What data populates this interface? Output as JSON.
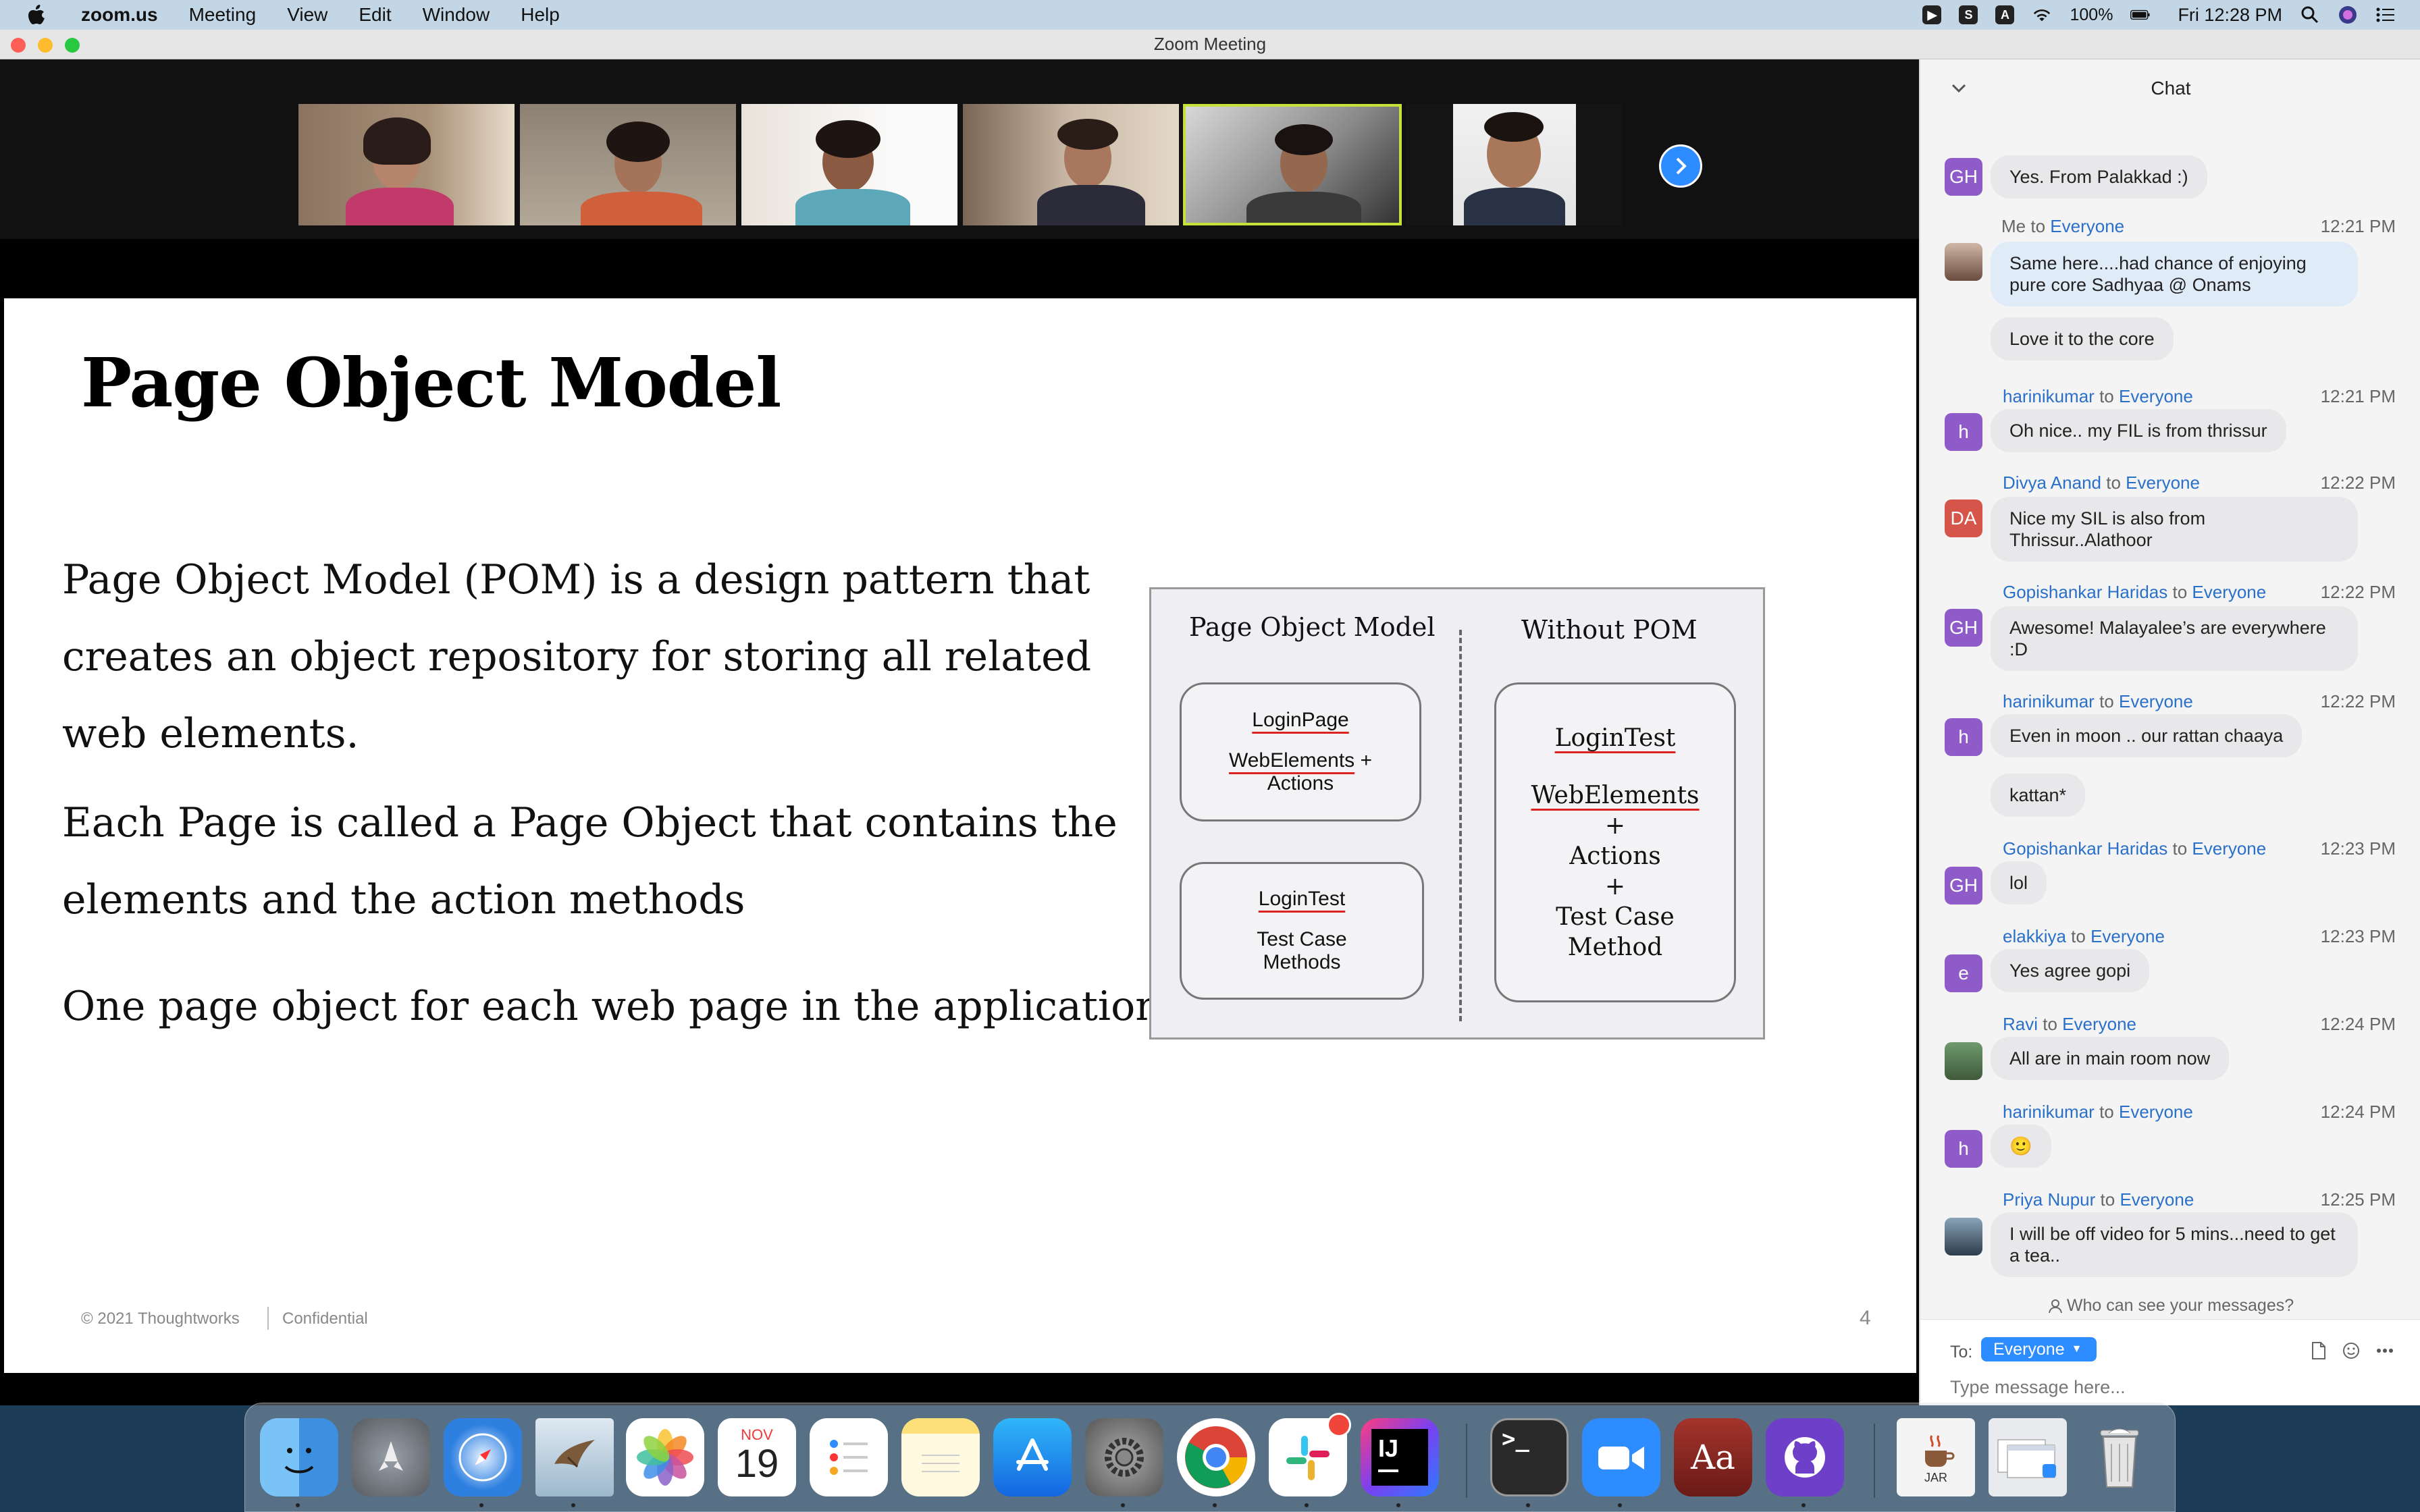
{
  "menubar": {
    "app_name": "zoom.us",
    "menus": [
      "Meeting",
      "View",
      "Edit",
      "Window",
      "Help"
    ],
    "battery": "100%",
    "clock": "Fri 12:28 PM"
  },
  "window": {
    "title": "Zoom Meeting"
  },
  "slide": {
    "title": "Page Object Model",
    "para1_line1": "Page Object Model (POM) is a design pattern that",
    "para1_line2": "creates an object repository for storing all related",
    "para1_line3": "web elements.",
    "para2_line1": "Each Page is called a Page Object that contains the",
    "para2_line2": "elements and the action methods",
    "para3": "One page object for each web page in the application",
    "footer_copyright": "© 2021 Thoughtworks",
    "footer_confidential": "Confidential",
    "page_number": "4",
    "diagram": {
      "left_heading": "Page Object Model",
      "right_heading": "Without POM",
      "box1_title": "LoginPage",
      "box1_line1": "WebElements",
      "box1_plus": "+",
      "box1_line2": "Actions",
      "box2_title": "LoginTest",
      "box2_line1": "Test Case",
      "box2_line2": "Methods",
      "box3_title": "LoginTest",
      "box3_line1": "WebElements",
      "box3_plus1": "+",
      "box3_line2": "Actions",
      "box3_plus2": "+",
      "box3_line3": "Test Case",
      "box3_line4": "Method"
    }
  },
  "chat": {
    "header": "Chat",
    "messages": [
      {
        "avatar": "GH",
        "text": "Yes. From Palakkad :)"
      },
      {
        "sender": "Me",
        "to": "to",
        "recipient": "Everyone",
        "time": "12:21 PM",
        "avatar": "",
        "text": "Same here....had chance of enjoying pure core Sadhyaa @ Onams",
        "text2": "Love it to the core"
      },
      {
        "sender": "harinikumar",
        "to": "to",
        "recipient": "Everyone",
        "time": "12:21 PM",
        "avatar": "h",
        "text": "Oh nice.. my FIL is from thrissur"
      },
      {
        "sender": "Divya Anand",
        "to": "to",
        "recipient": "Everyone",
        "time": "12:22 PM",
        "avatar": "DA",
        "text": "Nice my SIL is also from Thrissur..Alathoor"
      },
      {
        "sender": "Gopishankar Haridas",
        "to": "to",
        "recipient": "Everyone",
        "time": "12:22 PM",
        "avatar": "GH",
        "text": "Awesome! Malayalee’s are everywhere :D"
      },
      {
        "sender": "harinikumar",
        "to": "to",
        "recipient": "Everyone",
        "time": "12:22 PM",
        "avatar": "h",
        "text": "Even in moon .. our rattan chaaya",
        "text2": "kattan*"
      },
      {
        "sender": "Gopishankar Haridas",
        "to": "to",
        "recipient": "Everyone",
        "time": "12:23 PM",
        "avatar": "GH",
        "text": "lol"
      },
      {
        "sender": "elakkiya",
        "to": "to",
        "recipient": "Everyone",
        "time": "12:23 PM",
        "avatar": "e",
        "text": "Yes agree gopi"
      },
      {
        "sender": "Ravi",
        "to": "to",
        "recipient": "Everyone",
        "time": "12:24 PM",
        "avatar": "",
        "text": "All are in main room now"
      },
      {
        "sender": "harinikumar",
        "to": "to",
        "recipient": "Everyone",
        "time": "12:24 PM",
        "avatar": "h",
        "text": "🙂"
      },
      {
        "sender": "Priya Nupur",
        "to": "to",
        "recipient": "Everyone",
        "time": "12:25 PM",
        "avatar": "",
        "text": "I will be off video for 5 mins...need to get a tea.."
      }
    ],
    "who_can_see": "Who can see your messages?",
    "to_label": "To:",
    "to_value": "Everyone",
    "input_placeholder": "Type message here..."
  },
  "dock": {
    "calendar_month": "NOV",
    "calendar_day": "19",
    "jar_label": "JAR",
    "intellij_label": "IJ",
    "terminal_label": ">_",
    "dictionary_label": "Aa"
  },
  "colors": {
    "zoom_blue": "#2d8cff",
    "chat_link": "#2a70c9",
    "avatar_purple": "#8e5bc9",
    "avatar_red": "#d5554a"
  }
}
